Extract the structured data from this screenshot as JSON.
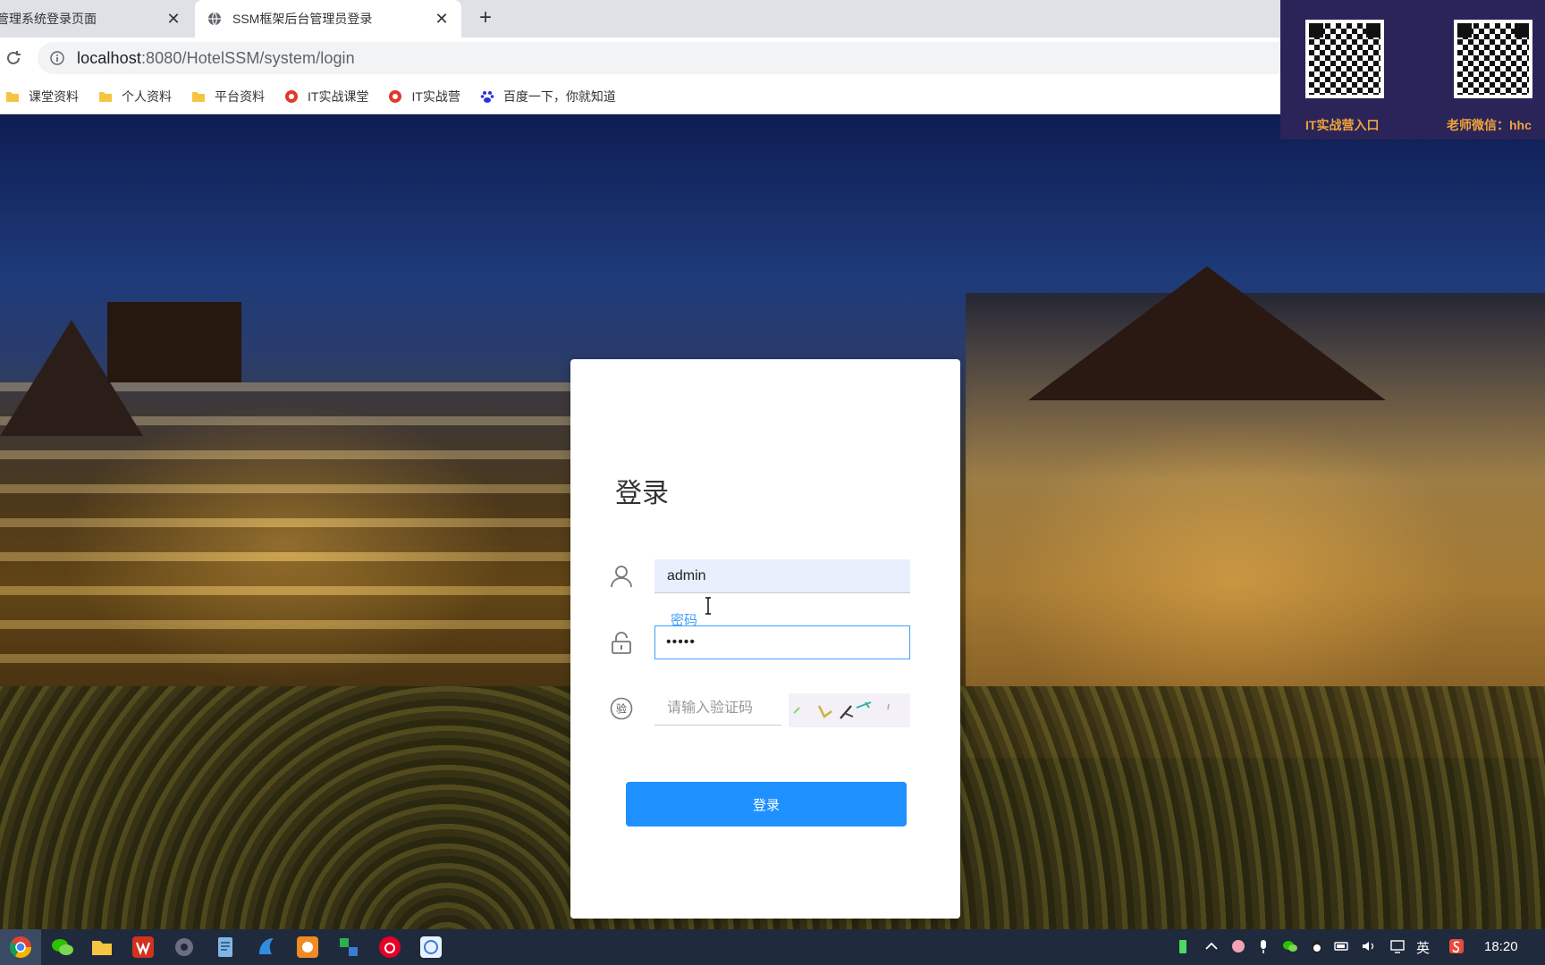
{
  "browser": {
    "tabs": [
      {
        "title": "管理系统登录页面",
        "active": false
      },
      {
        "title": "SSM框架后台管理员登录",
        "active": true
      }
    ],
    "close_glyph": "✕",
    "new_tab_glyph": "+",
    "url": {
      "host": "localhost",
      "rest": ":8080/HotelSSM/system/login"
    },
    "bookmarks": [
      {
        "label": "课堂资料",
        "icon": "folder-icon"
      },
      {
        "label": "个人资料",
        "icon": "folder-icon"
      },
      {
        "label": "平台资料",
        "icon": "folder-icon"
      },
      {
        "label": "IT实战课堂",
        "icon": "site-icon"
      },
      {
        "label": "IT实战营",
        "icon": "site-icon"
      },
      {
        "label": "百度一下，你就知道",
        "icon": "baidu-icon"
      }
    ]
  },
  "login": {
    "title": "登录",
    "username_value": "admin",
    "password_label": "密码",
    "password_value": "•••••",
    "captcha_placeholder": "请输入验证码",
    "captcha_icon_text": "验",
    "submit_label": "登录"
  },
  "promo": {
    "left_label": "IT实战营入口",
    "right_label": "老师微信：hhc"
  },
  "taskbar": {
    "ime": "英",
    "time": "18:20"
  },
  "colors": {
    "accent": "#1e90ff",
    "focus": "#409eff",
    "promo_bg": "#2a2458",
    "promo_text": "#f0a33a"
  }
}
